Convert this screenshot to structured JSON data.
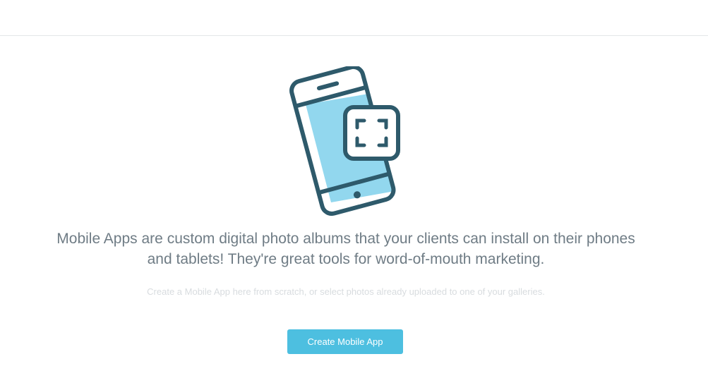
{
  "intro": {
    "headline": "Mobile Apps are custom digital photo albums that your clients can install on their phones and tablets! They're great tools for word-of-mouth marketing.",
    "subtext": "Create a Mobile App here from scratch, or select photos already uploaded to one of your galleries."
  },
  "actions": {
    "create_label": "Create Mobile App"
  },
  "illustration": {
    "icon": "mobile-app-phone-icon",
    "outline_color": "#2e5a6b",
    "screen_color": "#92d7ee"
  },
  "colors": {
    "button": "#4dbfe0",
    "headline_text": "#6f7c85",
    "subtext": "#d8dcdf"
  }
}
